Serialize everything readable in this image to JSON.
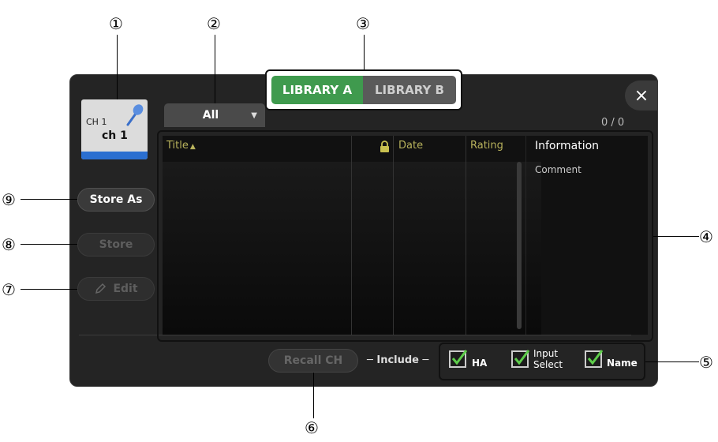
{
  "callouts": {
    "c1": "①",
    "c2": "②",
    "c3": "③",
    "c4": "④",
    "c5": "⑤",
    "c6": "⑥",
    "c7": "⑦",
    "c8": "⑧",
    "c9": "⑨"
  },
  "channel": {
    "number": "CH 1",
    "name": "ch 1",
    "icon": "microphone-icon",
    "color_bar": "#2b6fd0"
  },
  "sidebar": {
    "store_as": "Store As",
    "store": "Store",
    "edit": "Edit"
  },
  "filter": {
    "selected": "All"
  },
  "library_tabs": [
    {
      "label": "LIBRARY A",
      "active": true
    },
    {
      "label": "LIBRARY B",
      "active": false
    }
  ],
  "close_glyph": "×",
  "count": "0 / 0",
  "table": {
    "columns": {
      "title": "Title",
      "date": "Date",
      "rating": "Rating",
      "information": "Information"
    },
    "sort_indicator": "▲",
    "comment_label": "Comment"
  },
  "footer": {
    "recall": "Recall CH",
    "include": "─ Include ─",
    "options": [
      {
        "label": "HA",
        "checked": true
      },
      {
        "label_line1": "Input",
        "label_line2": "Select",
        "checked": true
      },
      {
        "label": "Name",
        "checked": true
      }
    ]
  },
  "colors": {
    "accent": "#3f9a4e",
    "header_text": "#b8b25c",
    "check": "#5dcc4a"
  }
}
